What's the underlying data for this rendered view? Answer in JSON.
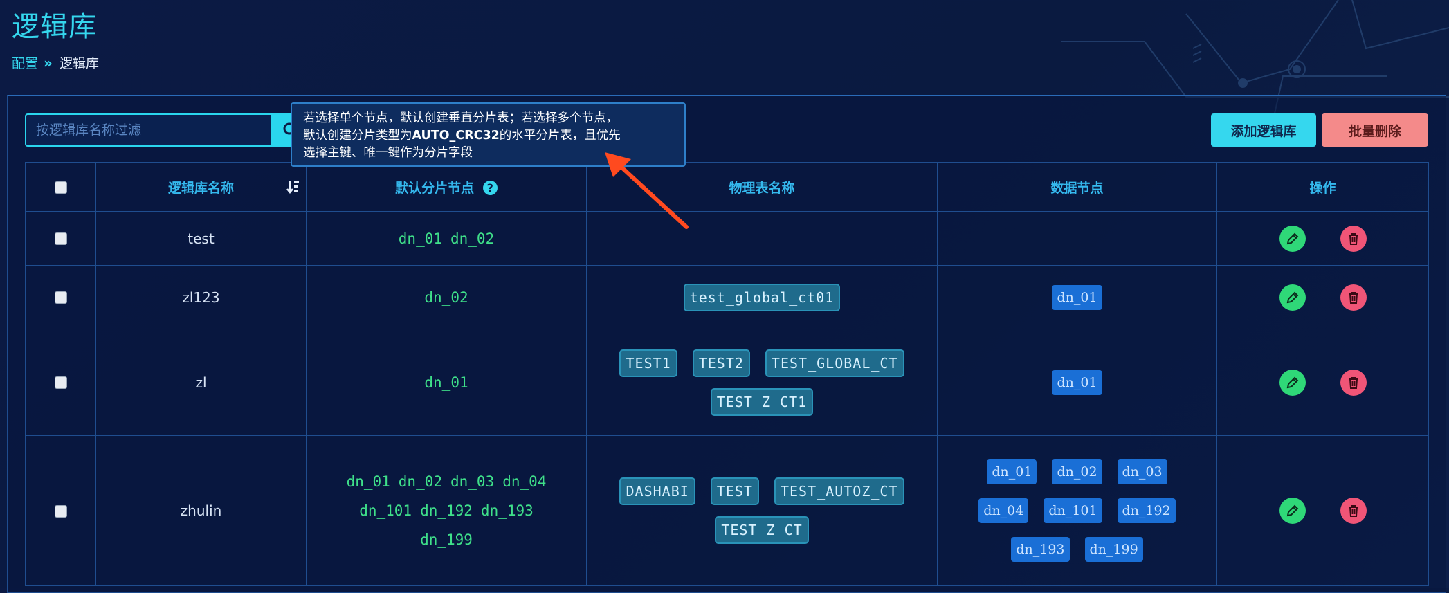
{
  "page": {
    "title": "逻辑库"
  },
  "breadcrumb": {
    "parent": "配置",
    "separator": "»",
    "current": "逻辑库"
  },
  "toolbar": {
    "search_placeholder": "按逻辑库名称过滤",
    "add_label": "添加逻辑库",
    "batch_delete_label": "批量删除"
  },
  "tooltip": {
    "line1": "若选择单个节点，默认创建垂直分片表；若选择多个节点，",
    "line2_prefix": "默认创建分片类型为",
    "line2_bold": "AUTO_CRC32",
    "line2_suffix": "的水平分片表，且优先",
    "line3": "选择主键、唯一键作为分片字段"
  },
  "table": {
    "headers": {
      "name": "逻辑库名称",
      "default_nodes": "默认分片节点",
      "help": "?",
      "physical_tables": "物理表名称",
      "data_nodes": "数据节点",
      "actions": "操作"
    },
    "rows": [
      {
        "name": "test",
        "default_nodes": [
          "dn_01",
          "dn_02"
        ],
        "physical_tables": [],
        "data_nodes": []
      },
      {
        "name": "zl123",
        "default_nodes": [
          "dn_02"
        ],
        "physical_tables": [
          "test_global_ct01"
        ],
        "data_nodes": [
          "dn_01"
        ]
      },
      {
        "name": "zl",
        "default_nodes": [
          "dn_01"
        ],
        "physical_tables": [
          "TEST1",
          "TEST2",
          "TEST_GLOBAL_CT",
          "TEST_Z_CT1"
        ],
        "data_nodes": [
          "dn_01"
        ]
      },
      {
        "name": "zhulin",
        "default_nodes": [
          "dn_01",
          "dn_02",
          "dn_03",
          "dn_04",
          "dn_101",
          "dn_192",
          "dn_193",
          "dn_199"
        ],
        "physical_tables": [
          "DASHABI",
          "TEST",
          "TEST_AUTOZ_CT",
          "TEST_Z_CT"
        ],
        "data_nodes": [
          "dn_01",
          "dn_02",
          "dn_03",
          "dn_04",
          "dn_101",
          "dn_192",
          "dn_193",
          "dn_199"
        ]
      }
    ]
  },
  "icons": {
    "search": "search-icon",
    "sort": "sort-icon",
    "help": "help-icon",
    "edit": "pencil-icon",
    "delete": "trash-icon"
  },
  "colors": {
    "accent": "#35d7ee",
    "edit": "#2fd878",
    "delete": "#f05577",
    "node_text": "#3fe08a",
    "tag_bg": "#1f6b8c",
    "dn_bg": "#1a6fd6"
  }
}
